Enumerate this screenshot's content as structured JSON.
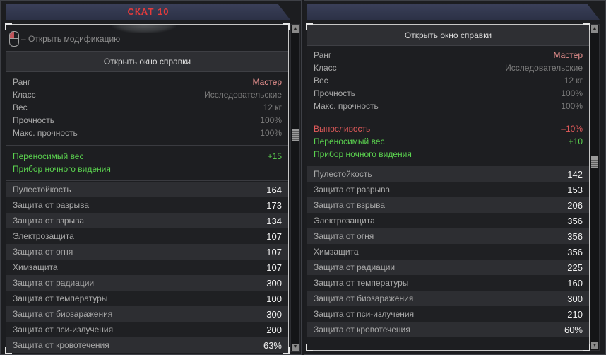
{
  "left": {
    "title": "СКАТ 10",
    "modification_hint": "– Открыть модификацию",
    "help_button": "Открыть окно справки",
    "info": [
      {
        "label": "Ранг",
        "value": "Мастер"
      },
      {
        "label": "Класс",
        "value": "Исследовательские"
      },
      {
        "label": "Вес",
        "value": "12 кг"
      },
      {
        "label": "Прочность",
        "value": "100%"
      },
      {
        "label": "Макс. прочность",
        "value": "100%"
      }
    ],
    "bonuses": [
      {
        "label": "Переносимый вес",
        "value": "+15",
        "color": "#5bd34f"
      },
      {
        "label": "Прибор ночного видения",
        "value": "",
        "color": "#5bd34f"
      }
    ],
    "stats": [
      {
        "label": "Пулестойкость",
        "value": "164"
      },
      {
        "label": "Защита от разрыва",
        "value": "173"
      },
      {
        "label": "Защита от взрыва",
        "value": "134"
      },
      {
        "label": "Электрозащита",
        "value": "107"
      },
      {
        "label": "Защита от огня",
        "value": "107"
      },
      {
        "label": "Химзащита",
        "value": "107"
      },
      {
        "label": "Защита от радиации",
        "value": "300"
      },
      {
        "label": "Защита от температуры",
        "value": "100"
      },
      {
        "label": "Защита от биозаражения",
        "value": "300"
      },
      {
        "label": "Защита от пси-излучения",
        "value": "200"
      },
      {
        "label": "Защита от кровотечения",
        "value": "63%"
      }
    ]
  },
  "right": {
    "help_button": "Открыть окно справки",
    "info": [
      {
        "label": "Ранг",
        "value": "Мастер"
      },
      {
        "label": "Класс",
        "value": "Исследовательские"
      },
      {
        "label": "Вес",
        "value": "12 кг"
      },
      {
        "label": "Прочность",
        "value": "100%"
      },
      {
        "label": "Макс. прочность",
        "value": "100%"
      }
    ],
    "bonuses": [
      {
        "label": "Выносливость",
        "value": "–10%",
        "color": "#e25a5a"
      },
      {
        "label": "Переносимый вес",
        "value": "+10",
        "color": "#5bd34f"
      },
      {
        "label": "Прибор ночного видения",
        "value": "",
        "color": "#5bd34f"
      }
    ],
    "stats": [
      {
        "label": "Пулестойкость",
        "value": "142"
      },
      {
        "label": "Защита от разрыва",
        "value": "153"
      },
      {
        "label": "Защита от взрыва",
        "value": "206"
      },
      {
        "label": "Электрозащита",
        "value": "356"
      },
      {
        "label": "Защита от огня",
        "value": "356"
      },
      {
        "label": "Химзащита",
        "value": "356"
      },
      {
        "label": "Защита от радиации",
        "value": "225"
      },
      {
        "label": "Защита от температуры",
        "value": "160"
      },
      {
        "label": "Защита от биозаражения",
        "value": "300"
      },
      {
        "label": "Защита от пси-излучения",
        "value": "210"
      },
      {
        "label": "Защита от кровотечения",
        "value": "60%"
      }
    ]
  },
  "icons": {
    "mouse": "mouse-left-click-icon",
    "scroll_up": "▲",
    "scroll_down": "▼"
  }
}
